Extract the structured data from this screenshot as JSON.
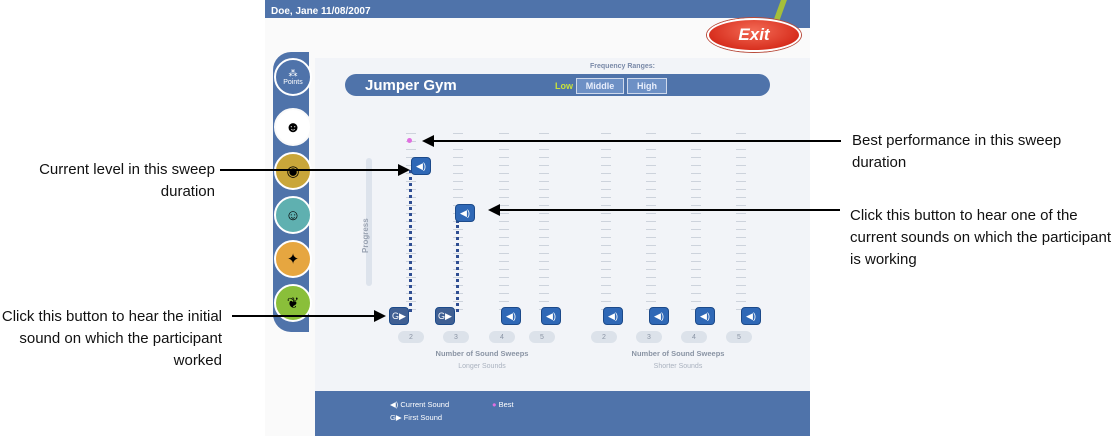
{
  "header": {
    "user": "Doe, Jane 11/08/2007",
    "exit_label": "Exit"
  },
  "game": {
    "title": "Jumper Gym"
  },
  "frequency": {
    "label": "Frequency Ranges:",
    "options": [
      "Low",
      "Middle",
      "High"
    ],
    "selected": "Low"
  },
  "sidebar": {
    "items": [
      {
        "icon": "points-icon",
        "label": "Points"
      },
      {
        "icon": "character-icon"
      },
      {
        "icon": "game-icon-1"
      },
      {
        "icon": "game-icon-2"
      },
      {
        "icon": "game-icon-3"
      },
      {
        "icon": "game-icon-4"
      }
    ]
  },
  "progress_label": "Progress",
  "groups": [
    {
      "title": "Number of Sound Sweeps",
      "subtitle": "Longer Sounds",
      "numbers": [
        "2",
        "3",
        "4",
        "5"
      ]
    },
    {
      "title": "Number of Sound Sweeps",
      "subtitle": "Shorter Sounds",
      "numbers": [
        "2",
        "3",
        "4",
        "5"
      ]
    }
  ],
  "legend": {
    "current": "Current Sound",
    "best": "Best",
    "first": "First Sound"
  },
  "callouts": {
    "best": "Best performance in this sweep duration",
    "current_level": "Current level in this sweep duration",
    "click_current": "Click this button to hear one of the current sounds on which the participant is working",
    "click_initial": "Click this button to hear the initial sound on which the participant worked"
  },
  "colors": {
    "panel_blue": "#4f73aa",
    "exit_red": "#d8301f",
    "button_blue": "#2f68b6",
    "best_pink": "#e06fe0",
    "low_green": "#c9e23a"
  }
}
